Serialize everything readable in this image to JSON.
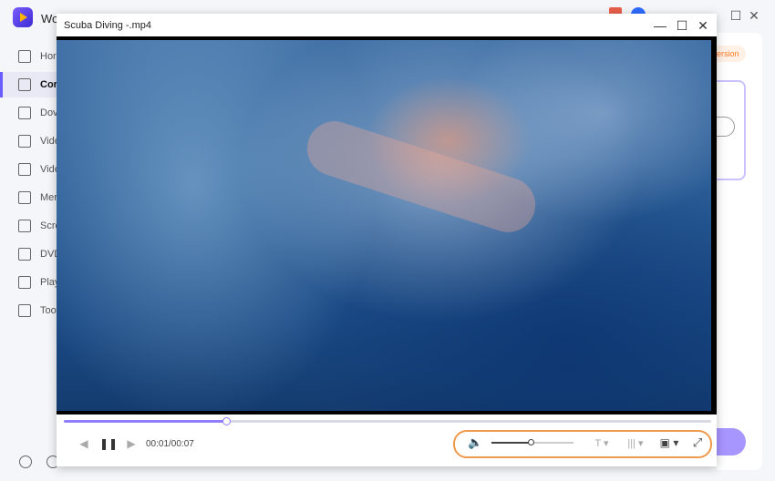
{
  "app": {
    "name": "Wo",
    "upgrade": "ersion",
    "window_controls": {
      "minimize": "—",
      "maximize": "☐",
      "close": "✕"
    }
  },
  "sidebar": {
    "items": [
      {
        "label": "Hor",
        "icon": "home-icon"
      },
      {
        "label": "Cor",
        "icon": "converter-icon",
        "active": true
      },
      {
        "label": "Dov",
        "icon": "download-icon"
      },
      {
        "label": "Vide",
        "icon": "video-compress-icon"
      },
      {
        "label": "Vide",
        "icon": "scissors-icon"
      },
      {
        "label": "Mer",
        "icon": "merge-icon"
      },
      {
        "label": "Scre",
        "icon": "screen-record-icon"
      },
      {
        "label": "DVD",
        "icon": "dvd-icon"
      },
      {
        "label": "Play",
        "icon": "player-icon"
      },
      {
        "label": "Too",
        "icon": "toolbox-icon"
      }
    ]
  },
  "player": {
    "title": "Scuba Diving -.mp4",
    "window_controls": {
      "minimize": "—",
      "maximize": "☐",
      "close": "✕"
    },
    "progress_fraction": 0.25,
    "time": "00:01/00:07",
    "volume_fraction": 0.48,
    "controls": {
      "prev": "◀",
      "pause": "❚❚",
      "next": "▶",
      "volume": "🔈",
      "subtitle": "T ▾",
      "audio_track": "||| ▾",
      "snapshot": "▣ ▾",
      "fullscreen": "⤢"
    }
  }
}
